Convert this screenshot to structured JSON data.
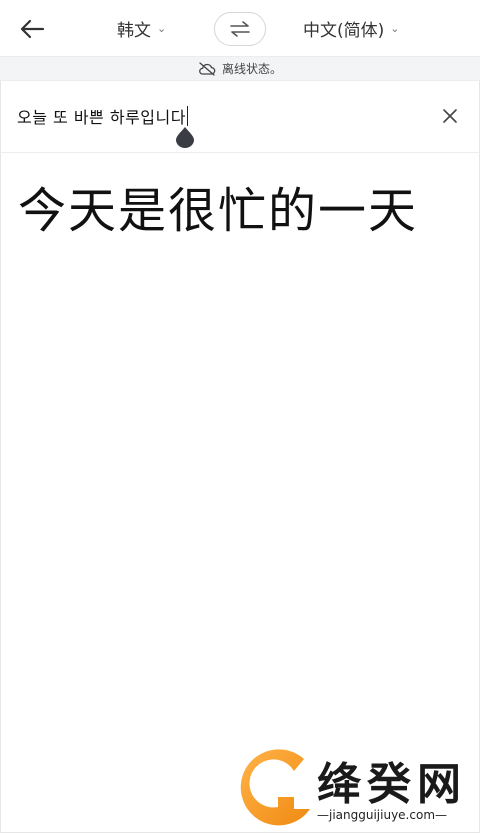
{
  "header": {
    "source_lang": "韩文",
    "target_lang": "中文(简体)"
  },
  "status": {
    "offline_text": "离线状态。"
  },
  "input": {
    "text": "오늘 또 바쁜 하루입니다"
  },
  "result": {
    "text": "今天是很忙的一天"
  },
  "watermark": {
    "brand": "绛癸网",
    "url": "—jiangguijiuye.com—"
  },
  "icons": {
    "back": "back-arrow-icon",
    "swap": "swap-icon",
    "offline": "offline-cloud-icon",
    "clear": "close-icon",
    "cursor_handle": "text-cursor-handle"
  },
  "colors": {
    "accent": "#f59b1c",
    "offline_bg": "#f3f4f6"
  }
}
